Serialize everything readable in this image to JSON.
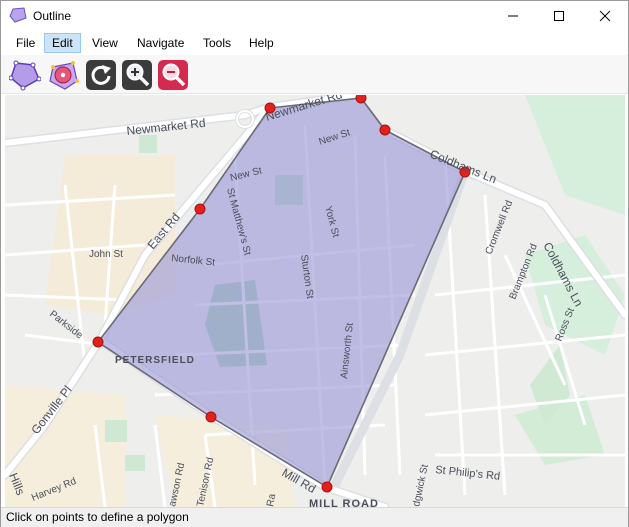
{
  "window": {
    "title": "Outline"
  },
  "menu": {
    "items": [
      "File",
      "Edit",
      "View",
      "Navigate",
      "Tools",
      "Help"
    ],
    "active": "Edit"
  },
  "toolbar": {
    "tools": [
      "polygon-tool",
      "point-tool",
      "refresh-tool",
      "zoom-in-tool",
      "zoom-out-tool"
    ]
  },
  "map": {
    "labels": {
      "newmarket_rd_left": "Newmarket Rd",
      "newmarket_rd_top": "Newmarket Rd",
      "coldhams_ln_top": "Coldhams Ln",
      "coldhams_ln_right": "Coldhams Ln",
      "new_st_top": "New St",
      "new_st_left": "New St",
      "st_matthews_st": "St Matthew's St",
      "east_rd": "East Rd",
      "york_st": "York St",
      "john_st": "John St",
      "norfolk_st": "Norfolk St",
      "sturton_st": "Sturton St",
      "cromwell_rd": "Cromwell Rd",
      "brampton_rd": "Brampton Rd",
      "ross_st": "Ross St",
      "parkside": "Parkside",
      "petersfield": "PETERSFIELD",
      "ainsworth_st": "Ainsworth St",
      "gonville_pl": "Gonville Pl",
      "harvey_rd": "Harvey Rd",
      "hills": "Hills",
      "mill_rd": "Mill Rd",
      "mill_road": "MILL ROAD",
      "tenison_rd": "Tenison Rd",
      "hawson_rd": "awson Rd",
      "dgwick_st": "dgwick St",
      "st_philips_rd": "St Philip's Rd",
      "ra": "Ra"
    },
    "polygon_color": "#9b97d6",
    "vertex_color": "#e3201b"
  },
  "status": {
    "text": "Click on points to define a polygon"
  }
}
